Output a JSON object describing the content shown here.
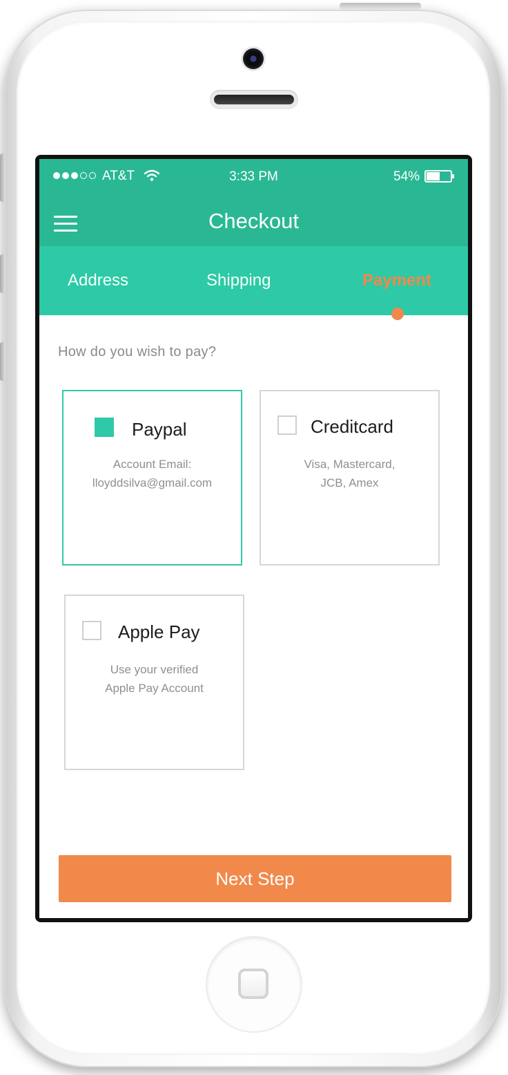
{
  "status_bar": {
    "carrier": "AT&T",
    "time": "3:33 PM",
    "battery_percent": "54%",
    "signal_bars_filled": 3,
    "signal_bars_total": 5,
    "battery_level": 0.54
  },
  "header": {
    "title": "Checkout",
    "menu_icon": "hamburger-menu-icon"
  },
  "tabs": [
    {
      "label": "Address",
      "active": false
    },
    {
      "label": "Shipping",
      "active": false
    },
    {
      "label": "Payment",
      "active": true
    }
  ],
  "question": "How do you wish to pay?",
  "payment_options": [
    {
      "title": "Paypal",
      "desc_line1": "Account Email:",
      "desc_line2": "lloyddsilva@gmail.com",
      "selected": true
    },
    {
      "title": "Creditcard",
      "desc_line1": "Visa, Mastercard,",
      "desc_line2": "JCB, Amex",
      "selected": false
    },
    {
      "title": "Apple Pay",
      "desc_line1": "Use your verified",
      "desc_line2": "Apple Pay Account",
      "selected": false
    }
  ],
  "next_button": {
    "label": "Next Step"
  },
  "colors": {
    "primary": "#2ab894",
    "tab_bar": "#2ec9a6",
    "accent": "#f0894a"
  }
}
